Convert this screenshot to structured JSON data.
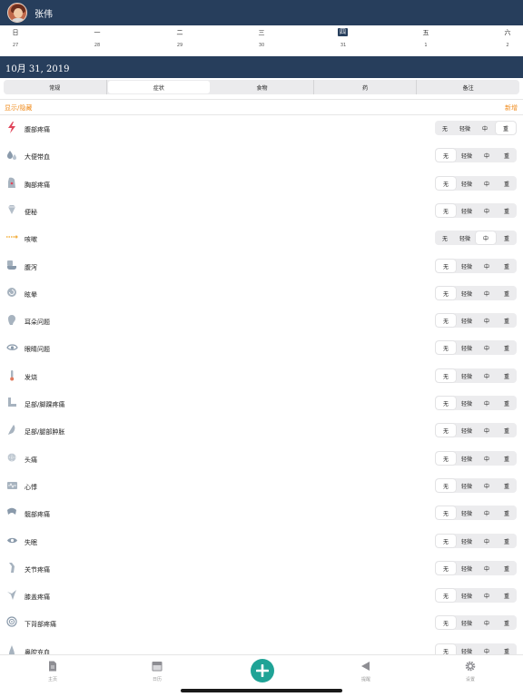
{
  "header": {
    "user_name": "张伟"
  },
  "week": {
    "days": [
      "日",
      "一",
      "二",
      "三",
      "四",
      "五",
      "六"
    ],
    "dates": [
      "27",
      "28",
      "29",
      "30",
      "31",
      "1",
      "2"
    ],
    "selected_index": 4
  },
  "date_bar": {
    "date": "10月 31, 2019"
  },
  "tabs": [
    {
      "label": "常规",
      "active": false
    },
    {
      "label": "症状",
      "active": true
    },
    {
      "label": "食物",
      "active": false
    },
    {
      "label": "药",
      "active": false
    },
    {
      "label": "备注",
      "active": false
    }
  ],
  "subbar": {
    "toggle_label": "显示/隐藏",
    "add_label": "新增"
  },
  "severity_labels": [
    "无",
    "轻微",
    "中",
    "重"
  ],
  "symptoms": [
    {
      "label": "腹部疼痛",
      "icon": "lightning-icon",
      "selected": 3
    },
    {
      "label": "大便带血",
      "icon": "blood-drops-icon",
      "selected": 0
    },
    {
      "label": "胸部疼痛",
      "icon": "chest-icon",
      "selected": 0
    },
    {
      "label": "便秘",
      "icon": "gem-icon",
      "selected": 0
    },
    {
      "label": "咳嗽",
      "icon": "cough-icon",
      "selected": 2
    },
    {
      "label": "腹泻",
      "icon": "toilet-icon",
      "selected": 0
    },
    {
      "label": "眩晕",
      "icon": "dizzy-icon",
      "selected": 0
    },
    {
      "label": "耳朵问题",
      "icon": "ear-icon",
      "selected": 0
    },
    {
      "label": "眼睛问题",
      "icon": "eye-icon",
      "selected": 0
    },
    {
      "label": "发烧",
      "icon": "thermometer-icon",
      "selected": 0
    },
    {
      "label": "足部/脚踝疼痛",
      "icon": "foot-icon",
      "selected": 0
    },
    {
      "label": "足部/腿部肿胀",
      "icon": "leg-icon",
      "selected": 0
    },
    {
      "label": "头痛",
      "icon": "head-icon",
      "selected": 0
    },
    {
      "label": "心悸",
      "icon": "heart-icon",
      "selected": 0
    },
    {
      "label": "髋部疼痛",
      "icon": "hip-icon",
      "selected": 0
    },
    {
      "label": "失眠",
      "icon": "closed-eye-icon",
      "selected": 0
    },
    {
      "label": "关节疼痛",
      "icon": "joint-icon",
      "selected": 0
    },
    {
      "label": "膝盖疼痛",
      "icon": "knee-icon",
      "selected": 0
    },
    {
      "label": "下背部疼痛",
      "icon": "target-icon",
      "selected": 0
    },
    {
      "label": "鼻腔充血",
      "icon": "nose-icon",
      "selected": 0
    }
  ],
  "tabbar": {
    "home": "主页",
    "calendar": "日历",
    "reminders": "提醒",
    "settings": "设置"
  },
  "colors": {
    "primary": "#273e5c",
    "accent": "#f08c1e",
    "add": "#1fa396",
    "icon": "#9aa7b4"
  }
}
